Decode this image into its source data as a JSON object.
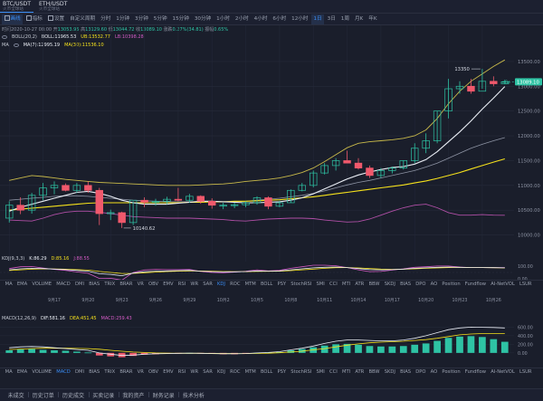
{
  "tabs": [
    {
      "symbol": "BTC/USDT",
      "sub": "火币全球站",
      "active": true
    },
    {
      "symbol": "ETH/USDT",
      "sub": "火币全球站",
      "active": false
    }
  ],
  "toolbar": {
    "items": [
      "画线",
      "指标",
      "设置",
      "自定义周期",
      "分时",
      "1分钟",
      "3分钟",
      "5分钟",
      "15分钟",
      "30分钟",
      "1小时",
      "2小时",
      "4小时",
      "6小时",
      "12小时",
      "1日",
      "3日",
      "1周",
      "月K",
      "年K"
    ],
    "selected": [
      "画线",
      "1日"
    ],
    "icons": [
      "pencil-icon",
      "indicator-icon",
      "settings-icon"
    ]
  },
  "ohlc": {
    "time": "时间2020-10-27 08:00",
    "open_label": "开",
    "open": "13053.95",
    "high_label": "高",
    "high": "13129.60",
    "low_label": "低",
    "low": "13044.72",
    "close_label": "收",
    "close": "13089.10",
    "change_label": "涨跌",
    "change": "0.27%(34.81)",
    "amp_label": "振幅",
    "amp": "0.65%"
  },
  "boll": {
    "name": "BOLL(20,2)",
    "boll": "BOLL:11965.53",
    "ub": "UB:13532.77",
    "lb": "LB:10398.28"
  },
  "ma": {
    "name": "MA",
    "ma7": "MA(7):12995.19",
    "ma30": "MA(30):11536.10"
  },
  "price_axis": [
    "13500.00",
    "13000.00",
    "12500.00",
    "12000.00",
    "11500.00",
    "11000.00",
    "10500.00",
    "10000.00"
  ],
  "current_price": "13089.10",
  "high_marker": "13350",
  "low_marker": "10140.62",
  "mini_tag": "+8s",
  "date_axis": [
    "9月17",
    "9月20",
    "9月23",
    "9月26",
    "9月29",
    "10月2",
    "10月5",
    "10月8",
    "10月11",
    "10月14",
    "10月17",
    "10月20",
    "10月23",
    "10月26"
  ],
  "kdj": {
    "name": "KDJ(9,3,3)",
    "k": "K:86.29",
    "d": "D:85.16",
    "j": "J:88.55",
    "axis": [
      "100.00",
      "50.00",
      "0.00"
    ]
  },
  "macd": {
    "name": "MACD(12,26,9)",
    "dif": "DIF:581.16",
    "dea": "DEA:451.45",
    "macd": "MACD:259.43",
    "axis": [
      "600.00",
      "400.00",
      "200.00",
      "0.00"
    ]
  },
  "indicator_tabs": [
    "MA",
    "EMA",
    "VOLUME",
    "MACD",
    "DMI",
    "BIAS",
    "TRIX",
    "BRAR",
    "VR",
    "OBV",
    "EMV",
    "RSI",
    "WR",
    "SAR",
    "KDJ",
    "ROC",
    "MTM",
    "BOLL",
    "PSY",
    "StochRSI",
    "SMI",
    "CCI",
    "MTI",
    "ATR",
    "BBW",
    "SKDJ",
    "BIAS",
    "DPO",
    "AO",
    "Position",
    "Fundflow",
    "AI-NetVOL",
    "LSUR"
  ],
  "tabs1_selected": "KDJ",
  "tabs2_selected": "MACD",
  "corner_label": "对数",
  "bottom_bar": [
    "未成交",
    "历史订单",
    "历史成交",
    "买卖记录",
    "我的资产",
    "财务记录",
    "技术分析"
  ],
  "colors": {
    "up": "#2ec3a4",
    "down": "#f0596c",
    "boll_band": "#c8b94a",
    "boll_lower": "#b04fa6",
    "ma7": "#e9edf4",
    "ma30": "#f5e11c",
    "accent": "#3a8df5"
  },
  "chart_data": {
    "type": "candlestick",
    "dates": [
      "9/13",
      "9/14",
      "9/15",
      "9/16",
      "9/17",
      "9/18",
      "9/19",
      "9/20",
      "9/21",
      "9/22",
      "9/23",
      "9/24",
      "9/25",
      "9/26",
      "9/27",
      "9/28",
      "9/29",
      "9/30",
      "10/1",
      "10/2",
      "10/3",
      "10/4",
      "10/5",
      "10/6",
      "10/7",
      "10/8",
      "10/9",
      "10/10",
      "10/11",
      "10/12",
      "10/13",
      "10/14",
      "10/15",
      "10/16",
      "10/17",
      "10/18",
      "10/19",
      "10/20",
      "10/21",
      "10/22",
      "10/23",
      "10/24",
      "10/25",
      "10/26",
      "10/27"
    ],
    "candles": [
      [
        10340,
        10680,
        10250,
        10600
      ],
      [
        10600,
        10760,
        10420,
        10500
      ],
      [
        10500,
        10850,
        10430,
        10800
      ],
      [
        10800,
        11050,
        10700,
        10950
      ],
      [
        10950,
        11080,
        10820,
        11000
      ],
      [
        11000,
        11040,
        10880,
        10900
      ],
      [
        10900,
        11050,
        10850,
        11000
      ],
      [
        11000,
        11080,
        10850,
        10900
      ],
      [
        10900,
        10950,
        10200,
        10430
      ],
      [
        10430,
        10510,
        10300,
        10450
      ],
      [
        10450,
        10470,
        10140,
        10250
      ],
      [
        10250,
        10680,
        10200,
        10700
      ],
      [
        10700,
        10760,
        10560,
        10660
      ],
      [
        10660,
        10730,
        10590,
        10680
      ],
      [
        10680,
        10770,
        10620,
        10720
      ],
      [
        10720,
        10950,
        10680,
        10700
      ],
      [
        10700,
        10830,
        10650,
        10780
      ],
      [
        10780,
        10800,
        10630,
        10680
      ],
      [
        10680,
        10740,
        10530,
        10600
      ],
      [
        10600,
        10650,
        10520,
        10600
      ],
      [
        10600,
        10650,
        10540,
        10610
      ],
      [
        10610,
        10680,
        10560,
        10650
      ],
      [
        10650,
        10780,
        10610,
        10750
      ],
      [
        10750,
        10780,
        10520,
        10580
      ],
      [
        10580,
        10690,
        10560,
        10650
      ],
      [
        10650,
        10920,
        10650,
        10900
      ],
      [
        10900,
        11050,
        10880,
        11000
      ],
      [
        11000,
        11300,
        10960,
        11250
      ],
      [
        11250,
        11450,
        11220,
        11400
      ],
      [
        11400,
        11550,
        11300,
        11500
      ],
      [
        11500,
        11700,
        11450,
        11450
      ],
      [
        11450,
        11550,
        11320,
        11350
      ],
      [
        11350,
        11400,
        11150,
        11200
      ],
      [
        11200,
        11350,
        11150,
        11300
      ],
      [
        11300,
        11380,
        11240,
        11350
      ],
      [
        11350,
        11500,
        11320,
        11500
      ],
      [
        11500,
        11850,
        11450,
        11750
      ],
      [
        11750,
        12050,
        11650,
        11900
      ],
      [
        11900,
        12500,
        11850,
        12500
      ],
      [
        12500,
        13150,
        12350,
        12950
      ],
      [
        12950,
        13100,
        12850,
        13000
      ],
      [
        13000,
        13150,
        12850,
        12900
      ],
      [
        12900,
        13350,
        12950,
        13100
      ],
      [
        13100,
        13200,
        13000,
        13050
      ],
      [
        13050,
        13130,
        13040,
        13090
      ]
    ],
    "y_range": [
      9700,
      13900
    ],
    "ma7": [
      10480,
      10560,
      10620,
      10680,
      10740,
      10800,
      10860,
      10880,
      10840,
      10780,
      10700,
      10650,
      10620,
      10620,
      10620,
      10640,
      10660,
      10680,
      10680,
      10670,
      10660,
      10650,
      10650,
      10660,
      10670,
      10700,
      10750,
      10830,
      10930,
      11030,
      11130,
      11210,
      11270,
      11320,
      11360,
      11380,
      11430,
      11520,
      11680,
      11880,
      12080,
      12300,
      12540,
      12760,
      12995
    ],
    "ma30": [
      10500,
      10520,
      10540,
      10560,
      10580,
      10600,
      10620,
      10640,
      10650,
      10650,
      10650,
      10650,
      10650,
      10650,
      10650,
      10650,
      10660,
      10660,
      10670,
      10670,
      10680,
      10680,
      10690,
      10700,
      10710,
      10730,
      10750,
      10770,
      10800,
      10830,
      10860,
      10890,
      10920,
      10950,
      10980,
      11010,
      11050,
      11090,
      11140,
      11200,
      11260,
      11330,
      11400,
      11470,
      11536
    ],
    "boll_upper": [
      11100,
      11150,
      11200,
      11180,
      11150,
      11120,
      11100,
      11080,
      11060,
      11050,
      11040,
      11030,
      11020,
      11010,
      11000,
      11000,
      11000,
      11010,
      11020,
      11030,
      11050,
      11080,
      11100,
      11120,
      11150,
      11200,
      11260,
      11350,
      11480,
      11620,
      11760,
      11850,
      11880,
      11900,
      11920,
      11950,
      12000,
      12120,
      12350,
      12650,
      12900,
      13100,
      13250,
      13400,
      13532
    ],
    "boll_mid": [
      10700,
      10720,
      10740,
      10760,
      10780,
      10790,
      10790,
      10780,
      10760,
      10740,
      10720,
      10700,
      10690,
      10680,
      10670,
      10670,
      10670,
      10670,
      10670,
      10670,
      10670,
      10680,
      10700,
      10720,
      10740,
      10770,
      10800,
      10840,
      10890,
      10950,
      11010,
      11060,
      11100,
      11150,
      11200,
      11250,
      11300,
      11370,
      11450,
      11550,
      11650,
      11750,
      11830,
      11900,
      11965
    ],
    "boll_lower": [
      10300,
      10290,
      10280,
      10340,
      10410,
      10460,
      10480,
      10480,
      10460,
      10430,
      10400,
      10370,
      10360,
      10350,
      10340,
      10340,
      10340,
      10330,
      10320,
      10310,
      10290,
      10280,
      10300,
      10320,
      10330,
      10340,
      10340,
      10330,
      10300,
      10280,
      10260,
      10270,
      10320,
      10400,
      10480,
      10550,
      10600,
      10620,
      10550,
      10450,
      10400,
      10400,
      10410,
      10400,
      10398
    ],
    "kdj_k": [
      70,
      78,
      82,
      80,
      76,
      72,
      66,
      60,
      40,
      35,
      25,
      45,
      55,
      60,
      62,
      64,
      66,
      60,
      56,
      54,
      55,
      57,
      62,
      60,
      62,
      70,
      78,
      86,
      90,
      92,
      88,
      80,
      72,
      70,
      72,
      76,
      82,
      86,
      90,
      92,
      90,
      88,
      88,
      87,
      86
    ],
    "kdj_d": [
      65,
      70,
      75,
      78,
      77,
      75,
      72,
      68,
      58,
      50,
      42,
      43,
      48,
      53,
      57,
      60,
      62,
      61,
      59,
      57,
      56,
      56,
      58,
      59,
      60,
      64,
      70,
      76,
      82,
      87,
      88,
      85,
      80,
      76,
      74,
      75,
      78,
      82,
      85,
      88,
      89,
      88,
      88,
      87,
      85
    ],
    "kdj_j": [
      80,
      94,
      96,
      84,
      74,
      66,
      54,
      44,
      4,
      5,
      -9,
      49,
      69,
      74,
      72,
      72,
      74,
      58,
      50,
      48,
      53,
      59,
      70,
      62,
      66,
      82,
      94,
      106,
      106,
      102,
      88,
      70,
      56,
      58,
      68,
      78,
      90,
      94,
      100,
      100,
      92,
      88,
      88,
      87,
      88
    ],
    "macd_hist": [
      60,
      80,
      90,
      70,
      60,
      50,
      30,
      10,
      -60,
      -80,
      -100,
      -70,
      -40,
      -30,
      -20,
      -10,
      0,
      -10,
      -20,
      -30,
      -30,
      -20,
      0,
      10,
      20,
      60,
      90,
      130,
      170,
      200,
      210,
      190,
      160,
      150,
      150,
      160,
      190,
      220,
      280,
      350,
      380,
      390,
      370,
      320,
      259
    ],
    "macd_dif": [
      120,
      140,
      150,
      140,
      120,
      100,
      80,
      60,
      0,
      -30,
      -60,
      -50,
      -30,
      -20,
      -15,
      -10,
      -5,
      -10,
      -15,
      -20,
      -20,
      -15,
      0,
      10,
      30,
      70,
      110,
      160,
      220,
      270,
      300,
      300,
      290,
      280,
      280,
      300,
      340,
      400,
      470,
      540,
      580,
      600,
      595,
      590,
      581
    ],
    "macd_dea": [
      80,
      90,
      100,
      110,
      110,
      110,
      105,
      100,
      85,
      60,
      40,
      20,
      10,
      0,
      -5,
      -8,
      -8,
      -10,
      -12,
      -14,
      -16,
      -16,
      -12,
      -6,
      4,
      20,
      40,
      70,
      100,
      140,
      180,
      210,
      235,
      250,
      260,
      270,
      290,
      310,
      340,
      380,
      420,
      440,
      450,
      452,
      451
    ]
  }
}
